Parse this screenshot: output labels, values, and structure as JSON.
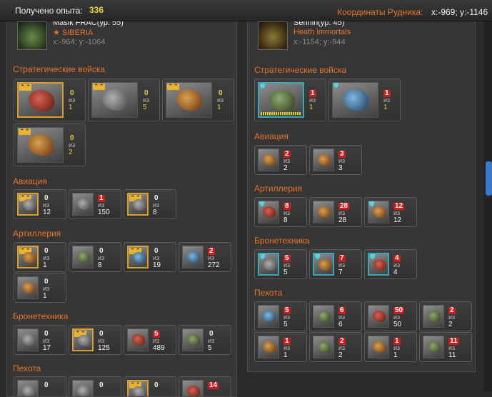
{
  "header": {
    "exp_label": "Получено опыта:",
    "exp_value": "336",
    "mine_label": "Координаты Рудника:",
    "mine_coords": "x:-969; y:-1146"
  },
  "left": {
    "player": {
      "name": "Masik FRAC(ур. 55)",
      "clan": "★ SIBERIA",
      "coords": "x:-964; y:-1064"
    },
    "sections": {
      "strategic": "Стратегические войска",
      "aviation": "Авиация",
      "artillery": "Артиллерия",
      "armor": "Бронетехника",
      "infantry": "Пехота"
    },
    "units": {
      "strategic": [
        {
          "count": "0",
          "of": "из",
          "total": "1"
        },
        {
          "count": "0",
          "of": "из",
          "total": "5"
        },
        {
          "count": "0",
          "of": "из",
          "total": "1"
        },
        {
          "count": "0",
          "of": "из",
          "total": "2"
        }
      ],
      "aviation": [
        {
          "count": "0",
          "of": "из",
          "total": "12"
        },
        {
          "count": "1",
          "of": "из",
          "total": "150"
        },
        {
          "count": "0",
          "of": "из",
          "total": "8"
        }
      ],
      "artillery": [
        {
          "count": "0",
          "of": "из",
          "total": "1"
        },
        {
          "count": "0",
          "of": "из",
          "total": "8"
        },
        {
          "count": "0",
          "of": "из",
          "total": "19"
        },
        {
          "count": "2",
          "of": "из",
          "total": "272"
        },
        {
          "count": "0",
          "of": "из",
          "total": "1"
        }
      ],
      "armor": [
        {
          "count": "0",
          "of": "из",
          "total": "17"
        },
        {
          "count": "0",
          "of": "из",
          "total": "125"
        },
        {
          "count": "5",
          "of": "из",
          "total": "489"
        },
        {
          "count": "0",
          "of": "из",
          "total": "5"
        }
      ],
      "infantry": [
        {
          "count": "0"
        },
        {
          "count": "0"
        },
        {
          "count": "0"
        },
        {
          "count": "14"
        }
      ]
    }
  },
  "right": {
    "player": {
      "name": "Sennin(ур. 45)",
      "clan": "Heath immortals",
      "coords": "x:-1154; y:-944"
    },
    "sections": {
      "strategic": "Стратегические войска",
      "aviation": "Авиация",
      "artillery": "Артиллерия",
      "armor": "Бронетехника",
      "infantry": "Пехота"
    },
    "units": {
      "strategic": [
        {
          "count": "1",
          "of": "из",
          "total": "1"
        },
        {
          "count": "1",
          "of": "из",
          "total": "1"
        }
      ],
      "aviation": [
        {
          "count": "2",
          "of": "из",
          "total": "2"
        },
        {
          "count": "3",
          "of": "из",
          "total": "3"
        }
      ],
      "artillery": [
        {
          "count": "8",
          "of": "из",
          "total": "8"
        },
        {
          "count": "28",
          "of": "из",
          "total": "28"
        },
        {
          "count": "12",
          "of": "из",
          "total": "12"
        }
      ],
      "armor": [
        {
          "count": "5",
          "of": "из",
          "total": "5"
        },
        {
          "count": "7",
          "of": "из",
          "total": "7"
        },
        {
          "count": "4",
          "of": "из",
          "total": "4"
        }
      ],
      "infantry": [
        {
          "count": "5",
          "of": "из",
          "total": "5"
        },
        {
          "count": "6",
          "of": "из",
          "total": "6"
        },
        {
          "count": "50",
          "of": "из",
          "total": "50"
        },
        {
          "count": "2",
          "of": "из",
          "total": "2"
        },
        {
          "count": "1",
          "of": "из",
          "total": "1"
        },
        {
          "count": "2",
          "of": "из",
          "total": "2"
        },
        {
          "count": "1",
          "of": "из",
          "total": "1"
        },
        {
          "count": "11",
          "of": "из",
          "total": "11"
        }
      ]
    }
  }
}
